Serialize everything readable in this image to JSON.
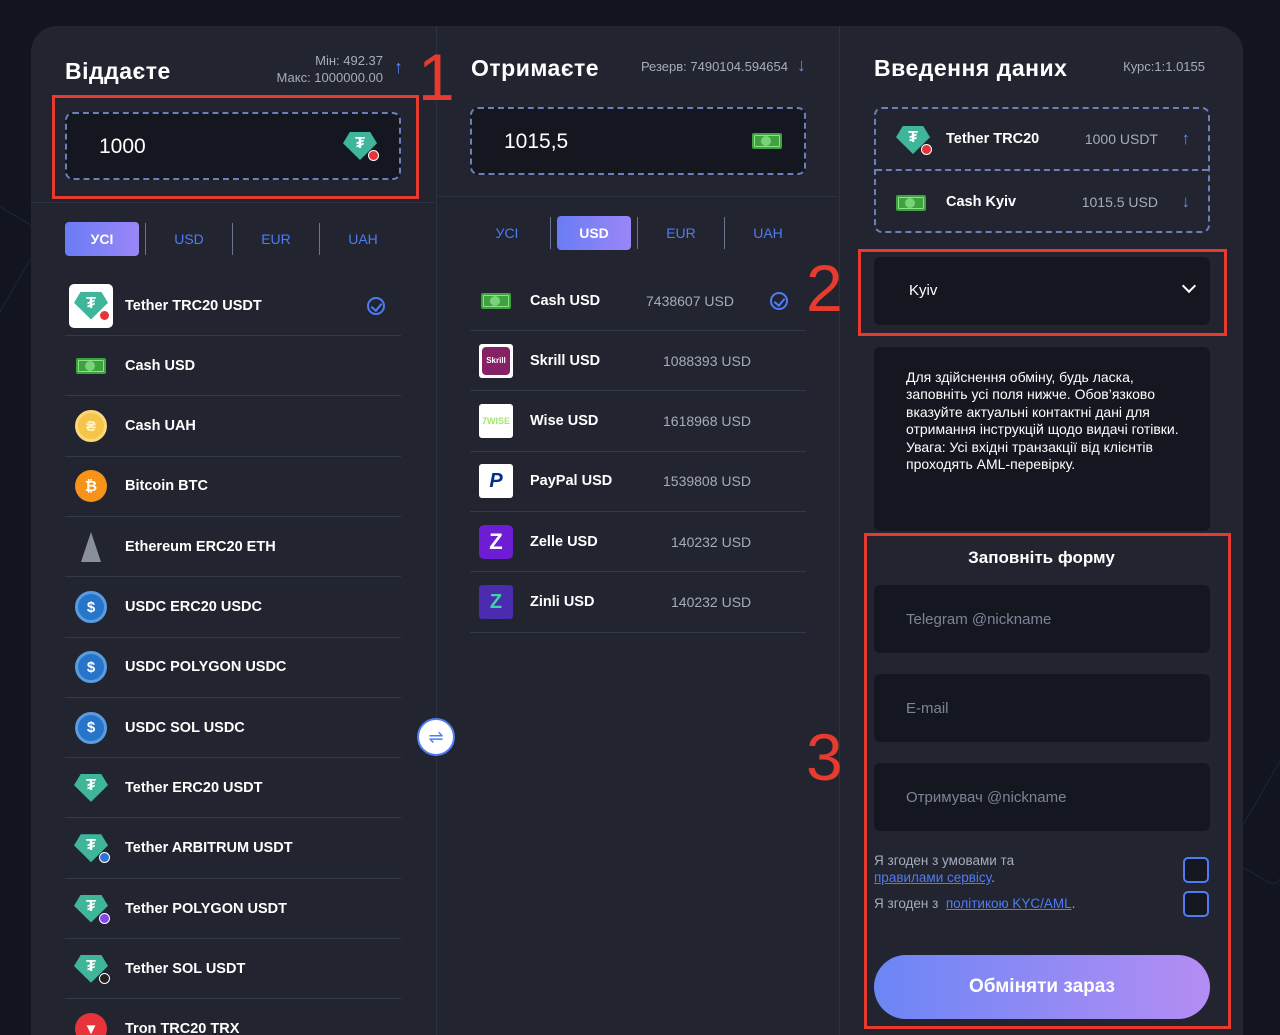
{
  "give": {
    "title": "Віддаєте",
    "min": "Мін: 492.37",
    "max": "Макс: 1000000.00",
    "amount": "1000",
    "tabs": [
      "УСІ",
      "USD",
      "EUR",
      "UAH"
    ],
    "items": [
      {
        "name": "Tether TRC20 USDT",
        "icon": "tether-trc20-icon"
      },
      {
        "name": "Cash USD",
        "icon": "cash-icon"
      },
      {
        "name": "Cash UAH",
        "icon": "hryvnia-coin-icon"
      },
      {
        "name": "Bitcoin BTC",
        "icon": "bitcoin-icon"
      },
      {
        "name": "Ethereum ERC20 ETH",
        "icon": "ethereum-icon"
      },
      {
        "name": "USDC ERC20 USDC",
        "icon": "usdc-icon"
      },
      {
        "name": "USDC POLYGON USDC",
        "icon": "usdc-icon"
      },
      {
        "name": "USDC SOL USDC",
        "icon": "usdc-icon"
      },
      {
        "name": "Tether ERC20 USDT",
        "icon": "tether-icon"
      },
      {
        "name": "Tether ARBITRUM USDT",
        "icon": "tether-arbitrum-icon"
      },
      {
        "name": "Tether POLYGON USDT",
        "icon": "tether-polygon-icon"
      },
      {
        "name": "Tether SOL USDT",
        "icon": "tether-sol-icon"
      },
      {
        "name": "Tron TRC20 TRX",
        "icon": "tron-icon"
      }
    ]
  },
  "get": {
    "title": "Отримаєте",
    "reserve": "Резерв: 7490104.594654",
    "amount": "1015,5",
    "tabs": [
      "УСІ",
      "USD",
      "EUR",
      "UAH"
    ],
    "items": [
      {
        "name": "Cash USD",
        "reserve": "7438607 USD",
        "icon": "cash-icon"
      },
      {
        "name": "Skrill USD",
        "reserve": "1088393 USD",
        "icon": "skrill-icon"
      },
      {
        "name": "Wise USD",
        "reserve": "1618968 USD",
        "icon": "wise-icon"
      },
      {
        "name": "PayPal USD",
        "reserve": "1539808 USD",
        "icon": "paypal-icon"
      },
      {
        "name": "Zelle USD",
        "reserve": "140232 USD",
        "icon": "zelle-icon"
      },
      {
        "name": "Zinli USD",
        "reserve": "140232 USD",
        "icon": "zinli-icon"
      }
    ]
  },
  "details": {
    "title": "Введення даних",
    "rate": "Курс:1:1.0155",
    "summary": [
      {
        "name": "Tether TRC20",
        "amount": "1000 USDT"
      },
      {
        "name": "Cash Kyiv",
        "amount": "1015.5 USD"
      }
    ],
    "city": "Kyiv",
    "info": "Для здійснення обміну, будь ласка, заповніть усі поля нижче. Обов’язково вказуйте актуальні контактні дані для отримання інструкцій щодо видачі готівки. Увага: Усі вхідні транзакції від клієнтів проходять AML-перевірку.",
    "form_title": "Заповніть форму",
    "telegram_placeholder": "Telegram @nickname",
    "email_placeholder": "E-mail",
    "recipient_placeholder": "Отримувач @nickname",
    "agree1_text": "Я згоден з умовами та",
    "agree1_link": "правилами сервісу",
    "agree2_text": "Я згоден з",
    "agree2_link": "політикою KYC/AML",
    "submit": "Обміняти зараз"
  },
  "annotations": [
    "1",
    "2",
    "3"
  ],
  "colors": {
    "accent": "#4f7cf3",
    "highlight": "#e63b2e",
    "panel": "#222430"
  }
}
